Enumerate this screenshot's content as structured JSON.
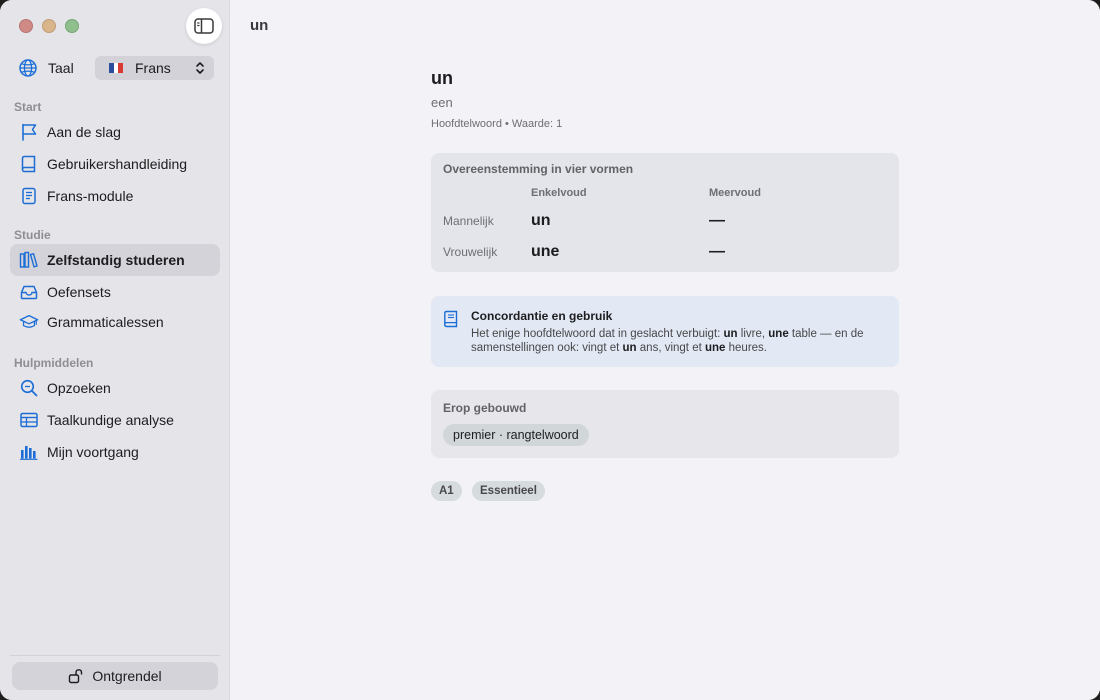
{
  "window": {
    "title": "un"
  },
  "sidebar": {
    "language": {
      "label": "Taal",
      "selected": "Frans",
      "flag_colors": [
        "#2b4c9b",
        "#ffffff",
        "#d83a34"
      ]
    },
    "sections": [
      {
        "label": "Start",
        "items": [
          {
            "label": "Aan de slag",
            "icon": "flag-icon"
          },
          {
            "label": "Gebruikershandleiding",
            "icon": "book-icon"
          },
          {
            "label": "Frans-module",
            "icon": "document-icon"
          }
        ]
      },
      {
        "label": "Studie",
        "items": [
          {
            "label": "Zelfstandig studeren",
            "icon": "books-icon",
            "active": true
          },
          {
            "label": "Oefensets",
            "icon": "tray-icon"
          },
          {
            "label": "Grammaticalessen",
            "icon": "graduation-cap-icon"
          }
        ]
      },
      {
        "label": "Hulpmiddelen",
        "items": [
          {
            "label": "Opzoeken",
            "icon": "magnifier-icon"
          },
          {
            "label": "Taalkundige analyse",
            "icon": "table-icon"
          },
          {
            "label": "Mijn voortgang",
            "icon": "bar-chart-icon"
          }
        ]
      }
    ],
    "unlock_label": "Ontgrendel"
  },
  "entry": {
    "word": "un",
    "translation": "een",
    "meta": "Hoofdtelwoord • Waarde: 1",
    "agreement": {
      "heading": "Overeenstemming in vier vormen",
      "columns": [
        "Enkelvoud",
        "Meervoud"
      ],
      "rows": [
        {
          "label": "Mannelijk",
          "singular": "un",
          "plural": "—"
        },
        {
          "label": "Vrouwelijk",
          "singular": "une",
          "plural": "—"
        }
      ]
    },
    "note": {
      "title": "Concordantie en gebruik",
      "t1": "Het enige hoofdtelwoord dat in geslacht verbuigt: ",
      "b1": "un",
      "t2": " livre, ",
      "b2": "une",
      "t3": " table — en de samenstellingen ook: vingt et ",
      "b3": "un",
      "t4": " ans, vingt et ",
      "b4": "une",
      "t5": " heures."
    },
    "built_on": {
      "heading": "Erop gebouwd",
      "chip": "premier · rangtelwoord"
    },
    "tags": [
      "A1",
      "Essentieel"
    ]
  },
  "colors": {
    "accent": "#1c6ed6"
  }
}
